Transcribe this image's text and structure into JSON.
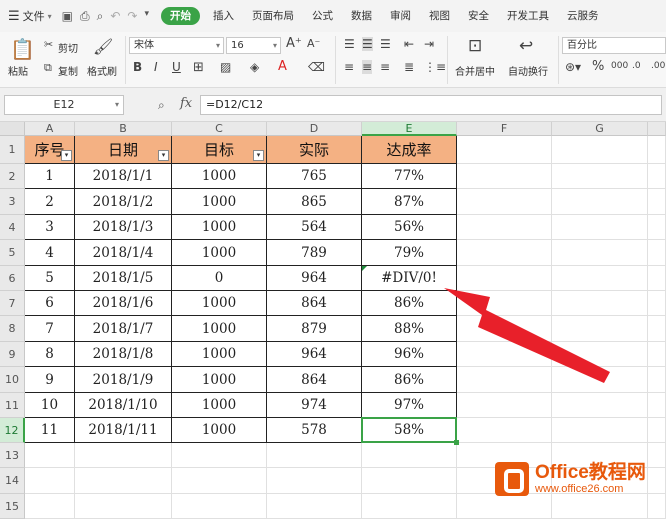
{
  "menubar": {
    "file_label": "文件",
    "tabs": [
      "开始",
      "插入",
      "页面布局",
      "公式",
      "数据",
      "审阅",
      "视图",
      "安全",
      "开发工具",
      "云服务"
    ]
  },
  "ribbon": {
    "paste_label": "粘贴",
    "cut_label": "剪切",
    "copy_label": "复制",
    "format_painter_label": "格式刷",
    "font_name": "宋体",
    "font_size": "16",
    "merge_center_label": "合并居中",
    "wrap_label": "自动换行",
    "number_format": "百分比"
  },
  "formula_bar": {
    "name_box": "E12",
    "fx_label": "fx",
    "formula": "=D12/C12"
  },
  "sheet": {
    "columns": [
      "A",
      "B",
      "C",
      "D",
      "E",
      "F",
      "G"
    ],
    "rows": [
      "1",
      "2",
      "3",
      "4",
      "5",
      "6",
      "7",
      "8",
      "9",
      "10",
      "11",
      "12",
      "13",
      "14",
      "15"
    ],
    "headers": [
      "序号",
      "日期",
      "目标",
      "实际",
      "达成率"
    ],
    "data": [
      [
        "1",
        "2018/1/1",
        "1000",
        "765",
        "77%"
      ],
      [
        "2",
        "2018/1/2",
        "1000",
        "865",
        "87%"
      ],
      [
        "3",
        "2018/1/3",
        "1000",
        "564",
        "56%"
      ],
      [
        "4",
        "2018/1/4",
        "1000",
        "789",
        "79%"
      ],
      [
        "5",
        "2018/1/5",
        "0",
        "964",
        "#DIV/0!"
      ],
      [
        "6",
        "2018/1/6",
        "1000",
        "864",
        "86%"
      ],
      [
        "7",
        "2018/1/7",
        "1000",
        "879",
        "88%"
      ],
      [
        "8",
        "2018/1/8",
        "1000",
        "964",
        "96%"
      ],
      [
        "9",
        "2018/1/9",
        "1000",
        "864",
        "86%"
      ],
      [
        "10",
        "2018/1/10",
        "1000",
        "974",
        "97%"
      ],
      [
        "11",
        "2018/1/11",
        "1000",
        "578",
        "58%"
      ]
    ]
  },
  "watermark": {
    "brand": "Office教程网",
    "url": "www.office26.com"
  },
  "colors": {
    "accent": "#3aa347",
    "header_fill": "#f4b183",
    "arrow": "#e8202a",
    "brand": "#e8590c"
  }
}
